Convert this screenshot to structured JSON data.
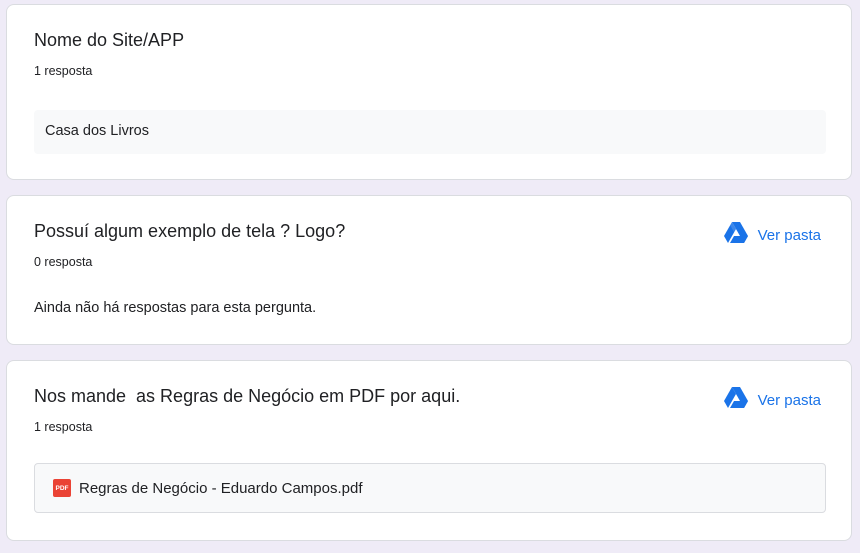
{
  "colors": {
    "background": "#efebf7",
    "card": "#ffffff",
    "link": "#1a73e8",
    "pdf_icon": "#ea4335",
    "drive_icon": "#1a73e8"
  },
  "questions": [
    {
      "title": "Nome do Site/APP",
      "count": "1 resposta",
      "answers": [
        "Casa dos Livros"
      ]
    },
    {
      "title": "Possuí algum exemplo de tela ? Logo?",
      "count": "0 resposta",
      "empty_text": "Ainda não há respostas para esta pergunta.",
      "folder_link": {
        "label": "Ver pasta",
        "icon": "google-drive-icon"
      }
    },
    {
      "title": "Nos mande  as Regras de Negócio em PDF por aqui.",
      "count": "1 resposta",
      "folder_link": {
        "label": "Ver pasta",
        "icon": "google-drive-icon"
      },
      "files": [
        {
          "name": "Regras de Negócio - Eduardo Campos.pdf",
          "icon": "pdf-icon",
          "icon_text": "PDF"
        }
      ]
    }
  ]
}
